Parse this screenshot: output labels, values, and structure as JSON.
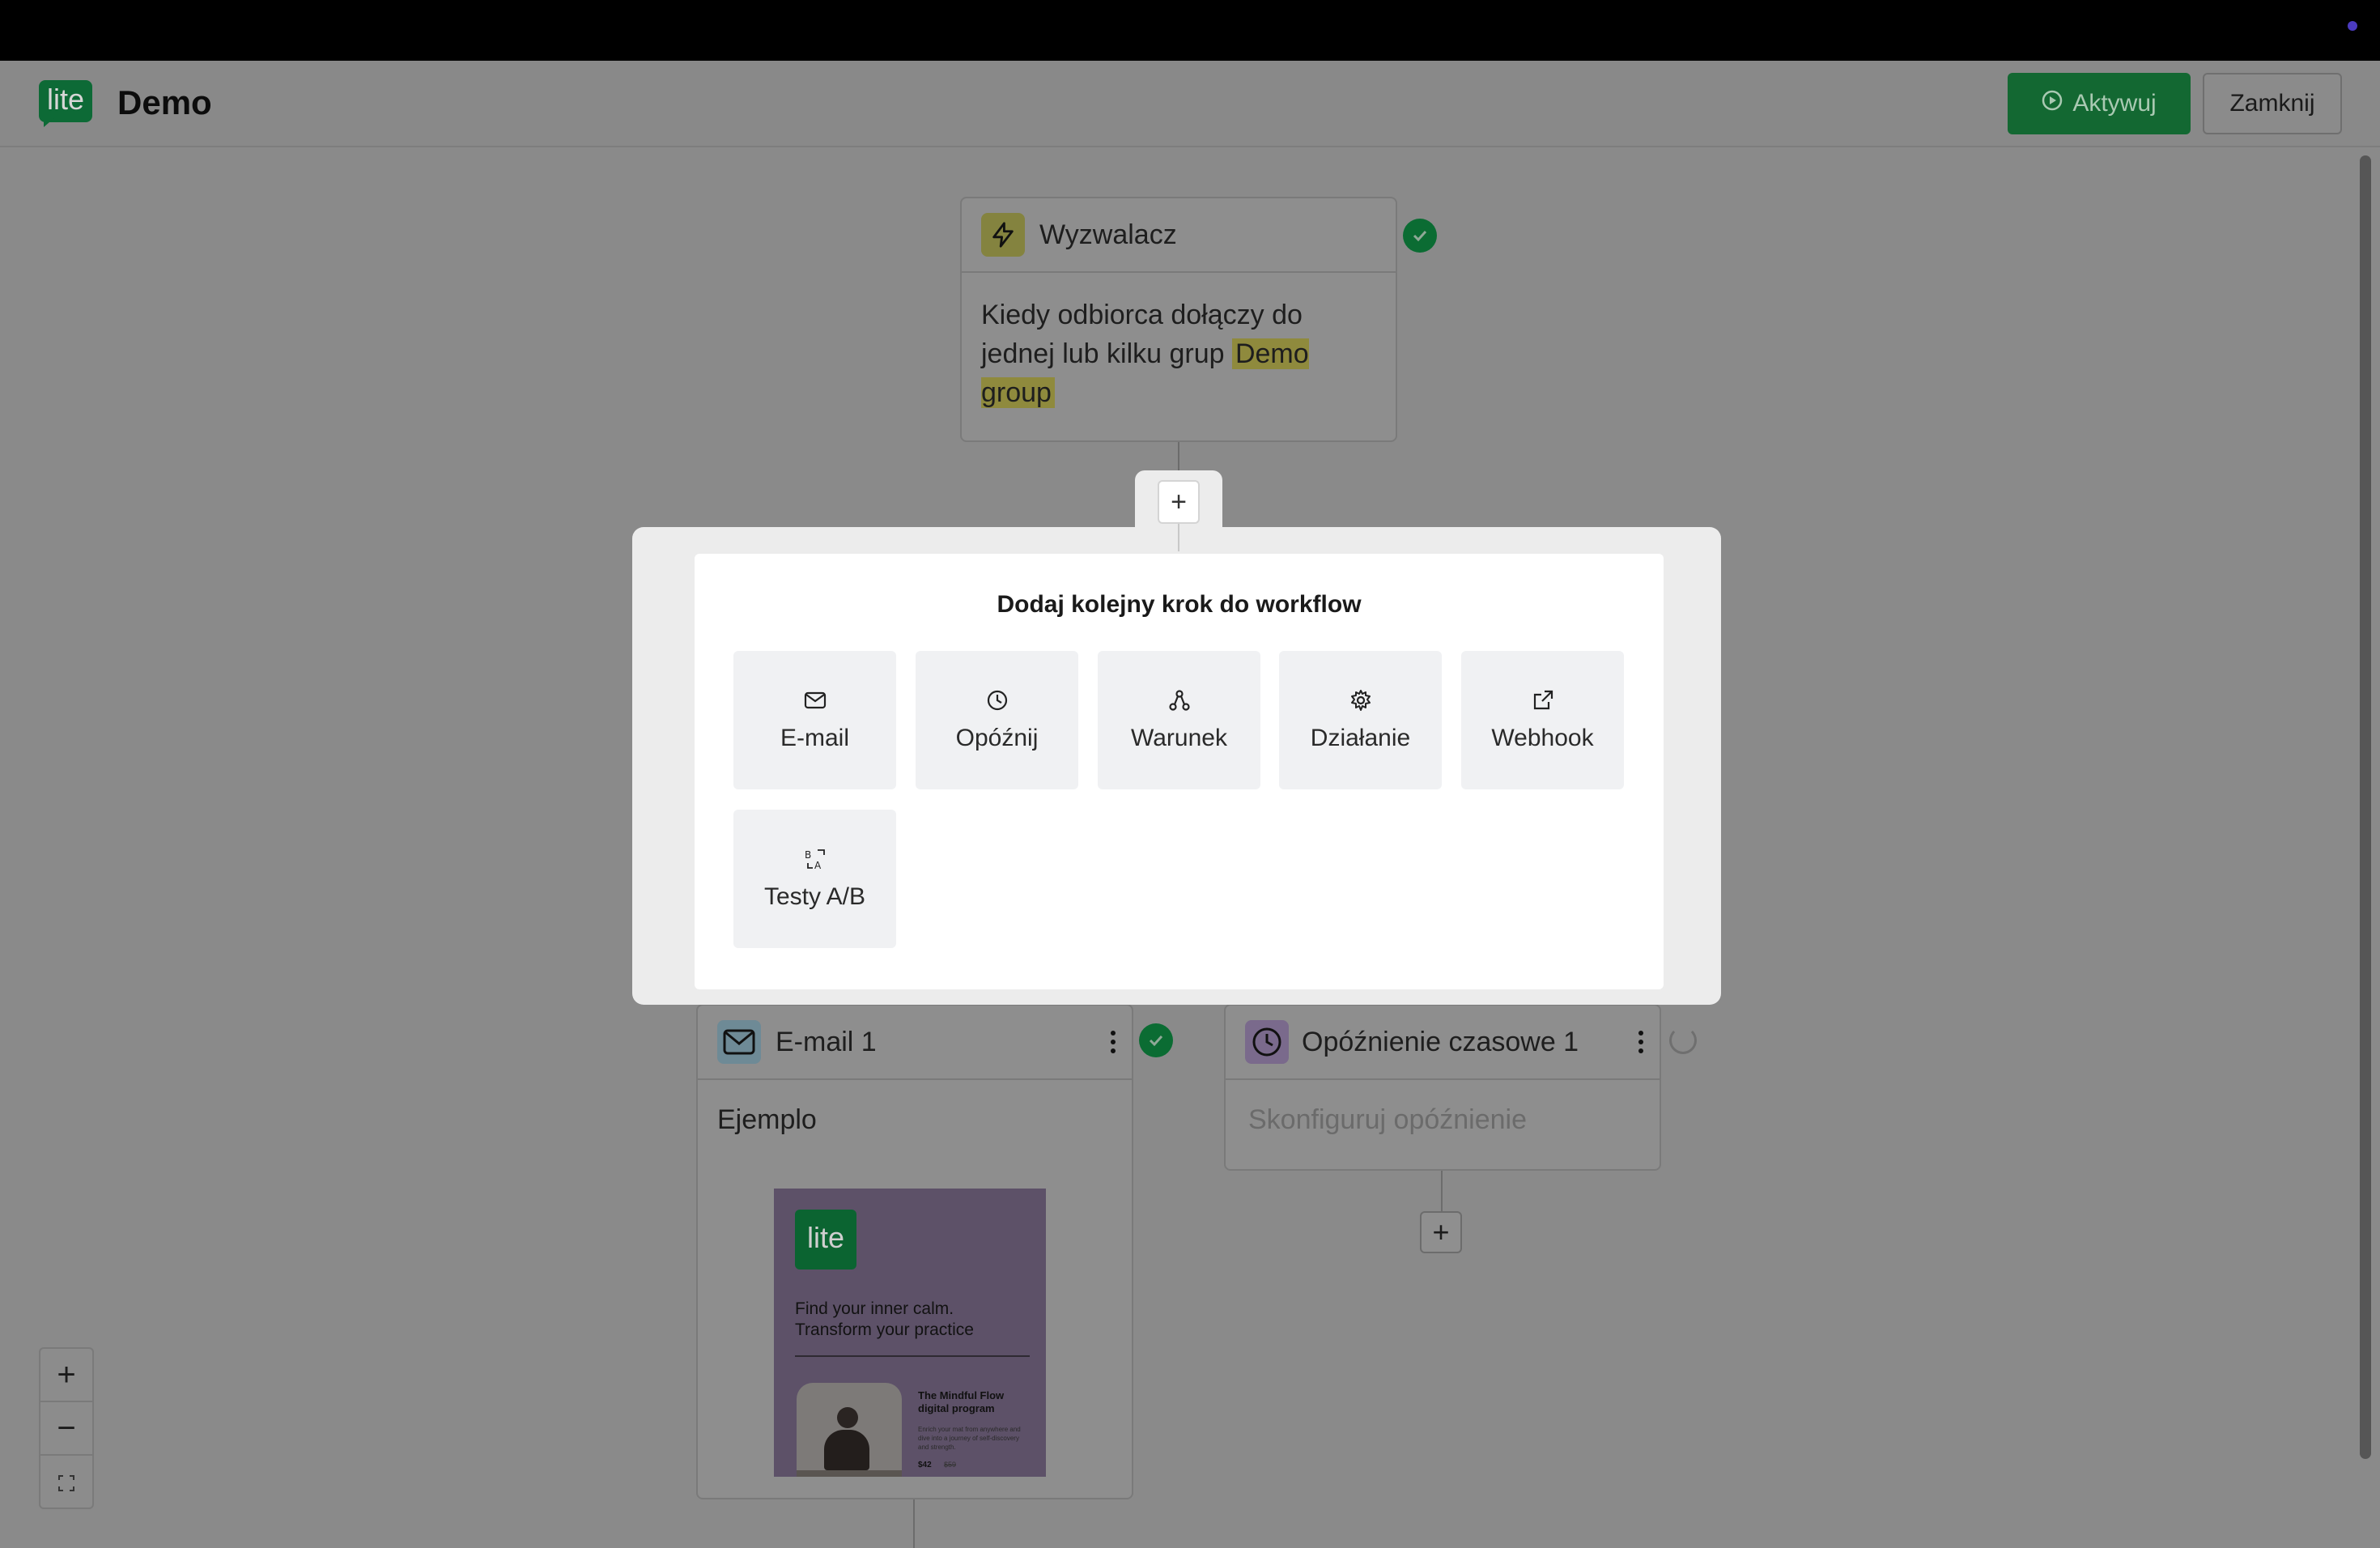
{
  "header": {
    "logo_text": "lite",
    "app_title": "Demo",
    "activate_label": "Aktywuj",
    "close_label": "Zamknij"
  },
  "trigger": {
    "title": "Wyzwalacz",
    "text_before": "Kiedy odbiorca dołączy do jednej lub kilku grup ",
    "group_name": "Demo group"
  },
  "email_node": {
    "title": "E-mail 1",
    "subject": "Ejemplo",
    "preview": {
      "logo_text": "lite",
      "headline": "Find your inner calm. Transform your practice",
      "product_title": "The Mindful Flow digital program",
      "product_desc": "Enrich your mat from anywhere and dive into a journey of self-discovery and strength.",
      "price": "$42",
      "old_price": "$59"
    }
  },
  "delay_node": {
    "title": "Opóźnienie czasowe 1",
    "placeholder": "Skonfiguruj opóźnienie"
  },
  "modal": {
    "title": "Dodaj kolejny krok do workflow",
    "options": [
      {
        "label": "E-mail",
        "icon": "mail-icon"
      },
      {
        "label": "Opóźnij",
        "icon": "clock-icon"
      },
      {
        "label": "Warunek",
        "icon": "branch-icon"
      },
      {
        "label": "Działanie",
        "icon": "gear-icon"
      },
      {
        "label": "Webhook",
        "icon": "external-link-icon"
      },
      {
        "label": "Testy A/B",
        "icon": "ab-test-icon"
      }
    ]
  },
  "zoom": {
    "zoom_in": "+",
    "zoom_out": "−"
  },
  "colors": {
    "brand_green": "#0d6a36",
    "check_green": "#0b6c33",
    "highlight": "#c7c04e"
  }
}
